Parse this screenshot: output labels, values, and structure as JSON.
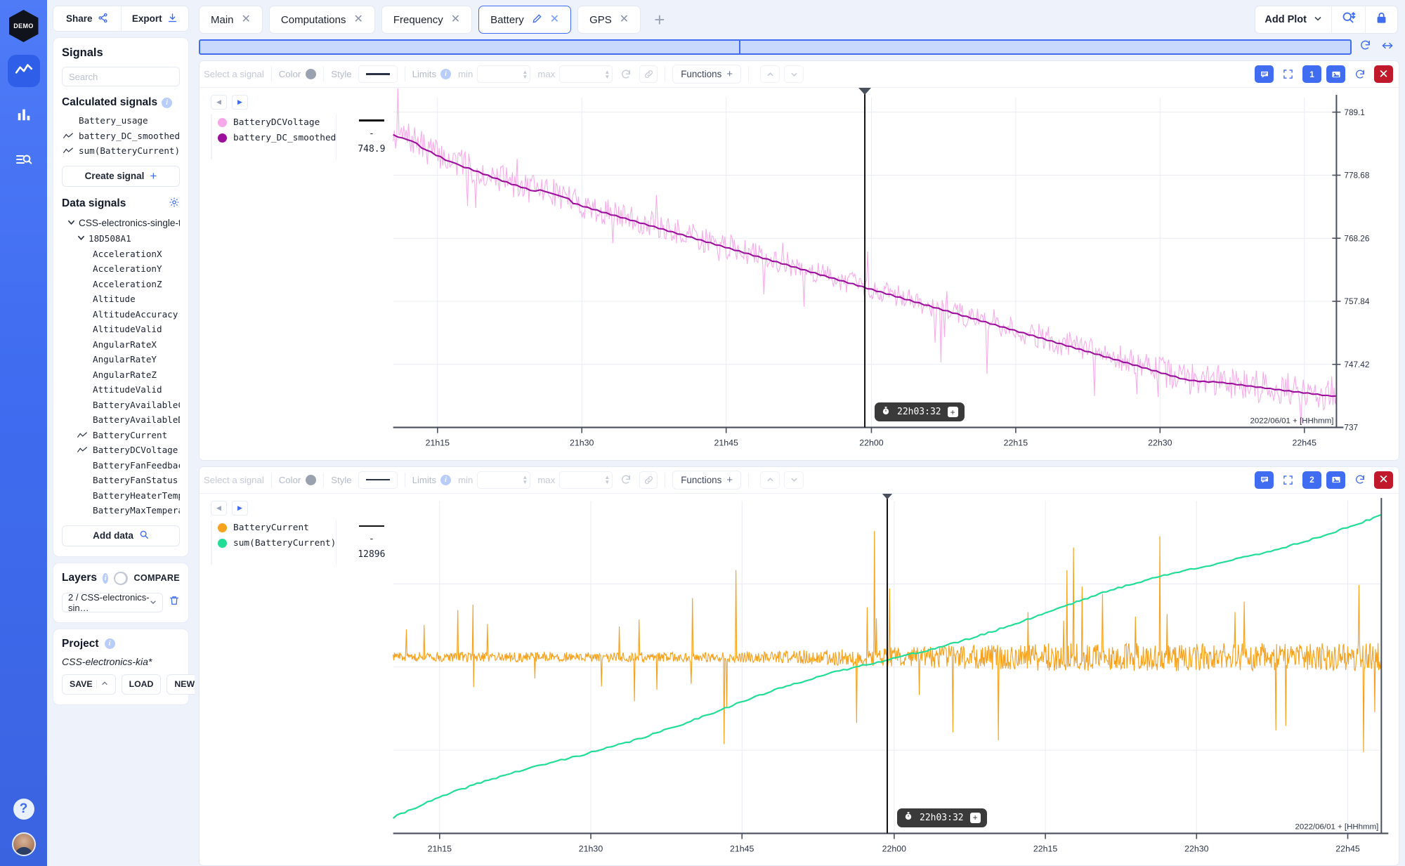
{
  "rail": {
    "logo": "DEMO",
    "items": [
      {
        "name": "plot-view",
        "icon": "line-chart-icon",
        "active": true
      },
      {
        "name": "bar-view",
        "icon": "bar-chart-icon",
        "active": false
      },
      {
        "name": "log-search",
        "icon": "list-search-icon",
        "active": false
      }
    ],
    "help": "?",
    "avatar": "user-avatar"
  },
  "sidebar": {
    "share_label": "Share",
    "export_label": "Export",
    "signals_title": "Signals",
    "search_placeholder": "Search",
    "calculated_title": "Calculated signals",
    "calculated": [
      {
        "label": "Battery_usage",
        "plotted": false
      },
      {
        "label": "battery_DC_smoothed",
        "plotted": true
      },
      {
        "label": "sum(BatteryCurrent)",
        "plotted": true
      }
    ],
    "create_signal_label": "Create signal",
    "data_signals_title": "Data signals",
    "device_label": "CSS-electronics-single-tim…",
    "message_label": "18D508A1",
    "data_signals": [
      {
        "label": "AccelerationX",
        "plotted": false
      },
      {
        "label": "AccelerationY",
        "plotted": false
      },
      {
        "label": "AccelerationZ",
        "plotted": false
      },
      {
        "label": "Altitude",
        "plotted": false
      },
      {
        "label": "AltitudeAccuracy",
        "plotted": false
      },
      {
        "label": "AltitudeValid",
        "plotted": false
      },
      {
        "label": "AngularRateX",
        "plotted": false
      },
      {
        "label": "AngularRateY",
        "plotted": false
      },
      {
        "label": "AngularRateZ",
        "plotted": false
      },
      {
        "label": "AttitudeValid",
        "plotted": false
      },
      {
        "label": "BatteryAvailableChar…",
        "plotted": false
      },
      {
        "label": "BatteryAvailableDisc…",
        "plotted": false
      },
      {
        "label": "BatteryCurrent",
        "plotted": true
      },
      {
        "label": "BatteryDCVoltage",
        "plotted": true
      },
      {
        "label": "BatteryFanFeedback",
        "plotted": false
      },
      {
        "label": "BatteryFanStatus",
        "plotted": false
      },
      {
        "label": "BatteryHeaterTempera…",
        "plotted": false
      },
      {
        "label": "BatteryMaxTemperature",
        "plotted": false
      }
    ],
    "add_data_label": "Add data",
    "layers_title": "Layers",
    "compare_label": "COMPARE",
    "layer_selected": "2 / CSS-electronics-sin…",
    "project_title": "Project",
    "project_name": "CSS-electronics-kia*",
    "save_label": "SAVE",
    "load_label": "LOAD",
    "new_label": "NEW"
  },
  "topbar": {
    "tabs": [
      {
        "label": "Main",
        "active": false,
        "editable": false
      },
      {
        "label": "Computations",
        "active": false,
        "editable": false
      },
      {
        "label": "Frequency",
        "active": false,
        "editable": false
      },
      {
        "label": "Battery",
        "active": true,
        "editable": true
      },
      {
        "label": "GPS",
        "active": false,
        "editable": false
      }
    ],
    "add_tab": "+",
    "add_plot_label": "Add Plot",
    "zoom_icon": "search-vertical-icon",
    "lock_icon": "lock-icon"
  },
  "timeline": {
    "reset_icon": "reset-icon",
    "fit_icon": "fit-width-icon",
    "left_fraction": 47
  },
  "toolbar": {
    "select_signal_placeholder": "Select a signal",
    "color_label": "Color",
    "style_label": "Style",
    "limits_label": "Limits",
    "min_label": "min",
    "max_label": "max",
    "min_value": "",
    "max_value": "",
    "functions_label": "Functions",
    "reset_icon": "reset-icon",
    "link_icon": "link-icon",
    "up_icon": "chevron-up-icon",
    "down_icon": "chevron-down-icon",
    "right_icons": [
      "comment-icon",
      "fullscreen-icon",
      "plot-number-icon",
      "image-icon",
      "reset-icon",
      "close-icon"
    ],
    "plot_number_1": "1",
    "plot_number_2": "2"
  },
  "chart_data": [
    {
      "id": "plot-battery-voltage",
      "type": "line",
      "title": "",
      "xlabel": "",
      "ylabel": "",
      "date_note": "2022/06/01 + [HHhmm]",
      "yticks": [
        789.1,
        778.68,
        768.26,
        757.84,
        747.42,
        737
      ],
      "ylim": [
        737,
        791.5
      ],
      "xticks": [
        "21h15",
        "21h30",
        "21h45",
        "22h00",
        "22h15",
        "22h30",
        "22h45"
      ],
      "xtick_fracs": [
        0.047,
        0.2,
        0.353,
        0.507,
        0.66,
        0.813,
        0.966
      ],
      "cursor": {
        "label": "22h03:32",
        "x_fraction": 0.5,
        "icon": "stopwatch-icon",
        "add_icon": "plus-icon"
      },
      "series": [
        {
          "name": "BatteryDCVoltage",
          "color": "#f7a8e8",
          "value": "-",
          "noisy": true,
          "points": [
            785.5,
            784.8,
            786.2,
            785.0,
            783.4,
            784.1,
            782.7,
            783.9,
            782.2,
            781.0,
            782.5,
            781.4,
            780.0,
            781.3,
            779.8,
            780.6,
            779.2,
            780.1,
            778.6,
            779.5,
            778.0,
            779.0,
            777.4,
            778.3,
            776.9,
            777.8,
            776.4,
            777.2,
            776.0,
            776.8,
            775.4,
            776.3,
            774.9,
            775.8,
            778.6,
            774.2,
            775.2,
            773.7,
            774.6,
            773.2,
            774.2,
            772.8,
            773.6,
            772.3,
            773.1,
            771.9,
            772.7,
            771.4,
            772.3,
            771.0,
            771.8,
            770.5,
            771.4,
            770.1,
            770.9,
            769.6,
            770.5,
            769.2,
            770.0,
            768.7,
            769.6,
            768.3,
            769.1,
            767.8,
            768.7,
            767.4,
            768.2,
            766.9,
            767.8,
            766.5,
            767.3,
            766.0,
            766.9,
            765.6,
            766.4,
            765.1,
            766.0,
            764.7,
            765.5,
            764.2,
            765.1,
            763.8,
            764.6,
            763.3,
            764.2,
            762.9,
            763.7,
            762.4,
            763.3,
            761.9,
            762.8,
            761.5,
            762.4,
            761.0,
            761.9,
            760.6,
            761.5,
            760.1,
            761.0,
            759.7,
            760.6,
            759.2,
            760.1,
            758.8,
            759.7,
            758.3,
            759.2,
            757.9,
            758.8,
            757.4,
            758.3,
            757.0,
            757.9,
            756.5,
            757.4,
            756.1,
            757.0,
            755.6,
            756.5,
            755.2,
            756.1,
            754.7,
            755.6,
            754.3,
            755.2,
            753.8,
            754.7,
            753.4,
            754.3,
            752.9,
            753.8,
            752.5,
            753.4,
            752.0,
            752.9,
            751.6,
            752.5,
            751.1,
            752.0,
            750.7,
            751.5,
            750.2,
            751.1,
            749.8,
            750.6,
            749.3,
            750.2,
            748.9,
            749.7,
            748.4,
            749.3,
            748.0,
            748.8,
            747.5,
            748.4,
            747.1,
            747.9,
            746.6,
            747.5,
            746.2,
            747.0,
            745.7,
            746.6,
            745.3,
            746.1,
            744.8,
            745.7,
            744.4,
            745.2,
            743.9,
            744.8,
            744.5,
            745.0,
            744.2,
            744.9,
            744.0,
            744.7,
            743.8,
            744.5,
            743.6,
            744.3,
            743.4,
            744.1,
            743.2,
            743.9,
            743.0,
            743.7,
            742.8,
            743.5,
            742.6,
            743.3,
            742.4,
            743.2,
            742.2,
            743.0,
            742.0,
            742.8,
            741.8,
            742.6,
            741.6
          ]
        },
        {
          "name": "battery_DC_smoothed",
          "color": "#9c0f9c",
          "value": "748.9",
          "noisy": false
        }
      ]
    },
    {
      "id": "plot-battery-current",
      "type": "line",
      "title": "",
      "xlabel": "",
      "ylabel": "",
      "date_note": "2022/06/01 + [HHhmm]",
      "yticks": [],
      "xticks": [
        "21h15",
        "21h30",
        "21h45",
        "22h00",
        "22h15",
        "22h30",
        "22h45"
      ],
      "xtick_fracs": [
        0.047,
        0.2,
        0.353,
        0.507,
        0.66,
        0.813,
        0.966
      ],
      "cursor": {
        "label": "22h03:32",
        "x_fraction": 0.5,
        "icon": "stopwatch-icon",
        "add_icon": "plus-icon"
      },
      "series": [
        {
          "name": "BatteryCurrent",
          "color": "#f6a21e",
          "value": "-",
          "noisy": true
        },
        {
          "name": "sum(BatteryCurrent)",
          "color": "#22dd96",
          "value": "12896",
          "noisy": false
        }
      ]
    }
  ]
}
